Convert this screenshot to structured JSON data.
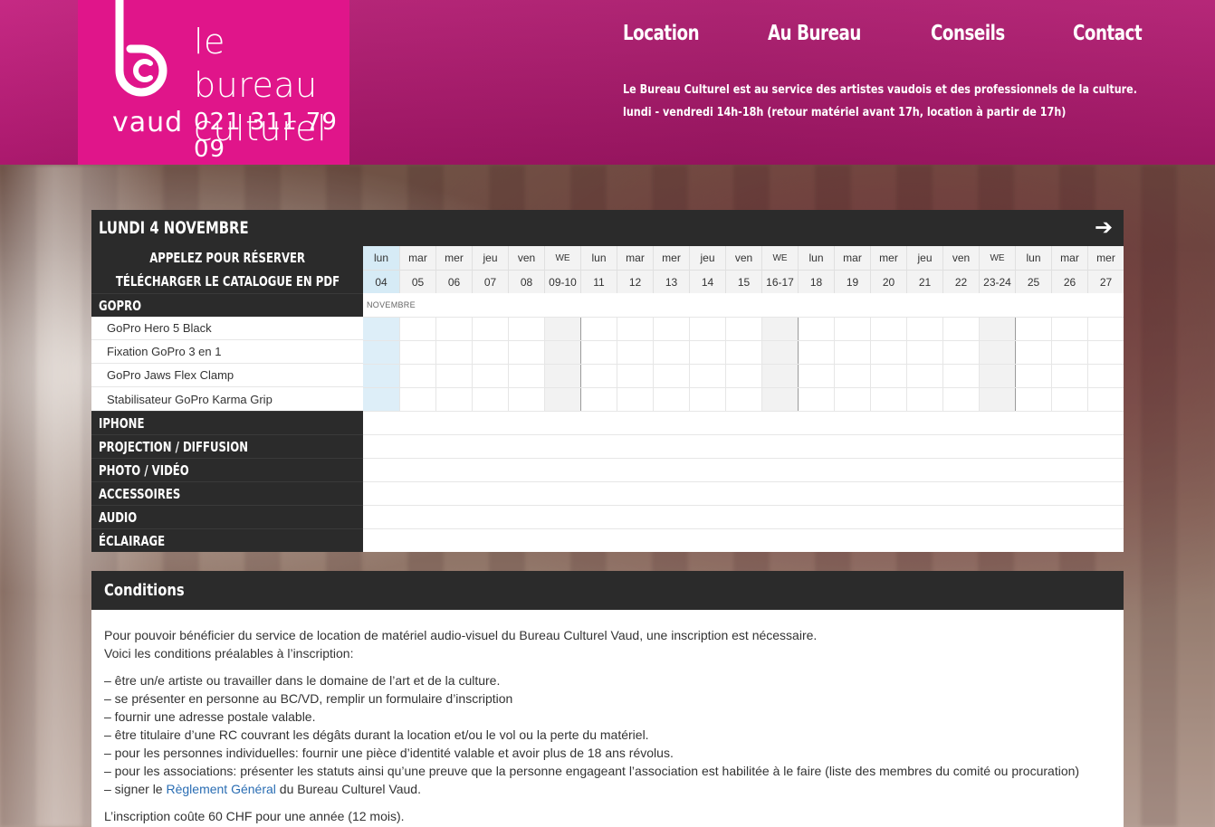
{
  "header": {
    "logo_line1": "le bureau",
    "logo_line2": "culturel",
    "logo_region": "vaud",
    "logo_phone": "021 311 79 09",
    "nav": [
      {
        "label": "Location"
      },
      {
        "label": "Au Bureau"
      },
      {
        "label": "Conseils"
      },
      {
        "label": "Contact"
      }
    ],
    "tagline_line1": "Le Bureau Culturel est au service des artistes vaudois et des professionnels de la culture.",
    "tagline_line2": "lundi - vendredi 14h-18h (retour matériel avant 17h, location à partir de 17h)"
  },
  "calendar": {
    "title": "LUNDI 4 NOVEMBRE",
    "next_icon": "arrow-right-icon",
    "call_label": "APPELEZ POUR RÉSERVER",
    "catalog_label": "TÉLÉCHARGER LE CATALOGUE EN PDF",
    "month_label": "NOVEMBRE",
    "days": [
      {
        "day": "lun",
        "date": "04",
        "today": true
      },
      {
        "day": "mar",
        "date": "05"
      },
      {
        "day": "mer",
        "date": "06"
      },
      {
        "day": "jeu",
        "date": "07"
      },
      {
        "day": "ven",
        "date": "08"
      },
      {
        "day": "WE",
        "date": "09-10",
        "weekend": true
      },
      {
        "day": "lun",
        "date": "11"
      },
      {
        "day": "mar",
        "date": "12"
      },
      {
        "day": "mer",
        "date": "13"
      },
      {
        "day": "jeu",
        "date": "14"
      },
      {
        "day": "ven",
        "date": "15"
      },
      {
        "day": "WE",
        "date": "16-17",
        "weekend": true
      },
      {
        "day": "lun",
        "date": "18"
      },
      {
        "day": "mar",
        "date": "19"
      },
      {
        "day": "mer",
        "date": "20"
      },
      {
        "day": "jeu",
        "date": "21"
      },
      {
        "day": "ven",
        "date": "22"
      },
      {
        "day": "WE",
        "date": "23-24",
        "weekend": true
      },
      {
        "day": "lun",
        "date": "25"
      },
      {
        "day": "mar",
        "date": "26"
      },
      {
        "day": "mer",
        "date": "27"
      }
    ],
    "category_open": "GOPRO",
    "items": [
      "GoPro Hero 5 Black",
      "Fixation GoPro 3 en 1",
      "GoPro Jaws Flex Clamp",
      "Stabilisateur GoPro Karma Grip"
    ],
    "categories_closed": [
      "IPHONE",
      "PROJECTION / DIFFUSION",
      "PHOTO / VIDÉO",
      "ACCESSOIRES",
      "AUDIO",
      "ÉCLAIRAGE"
    ]
  },
  "conditions": {
    "title": "Conditions",
    "intro1": "Pour pouvoir bénéficier du service de location de matériel audio-visuel du Bureau Culturel Vaud, une inscription est nécessaire.",
    "intro2": "Voici les conditions préalables à l’inscription:",
    "list": [
      "– être un/e artiste ou travailler dans le domaine de l’art et de la culture.",
      "– se présenter en personne au BC/VD, remplir un formulaire d’inscription",
      "– fournir une adresse postale valable.",
      "– être titulaire d’une RC couvrant les dégâts durant la location et/ou le vol ou la perte du matériel.",
      "– pour les personnes individuelles: fournir une pièce d’identité valable et avoir plus de 18 ans révolus.",
      "– pour les associations: présenter les statuts ainsi qu’une preuve que la personne engageant l’association est habilitée à le faire (liste des membres du comité ou procuration)"
    ],
    "last_prefix": "– signer le ",
    "last_link": "Règlement Général",
    "last_suffix": " du Bureau Culturel Vaud.",
    "fee": "L’inscription coûte 60 CHF pour une année (12 mois)."
  }
}
